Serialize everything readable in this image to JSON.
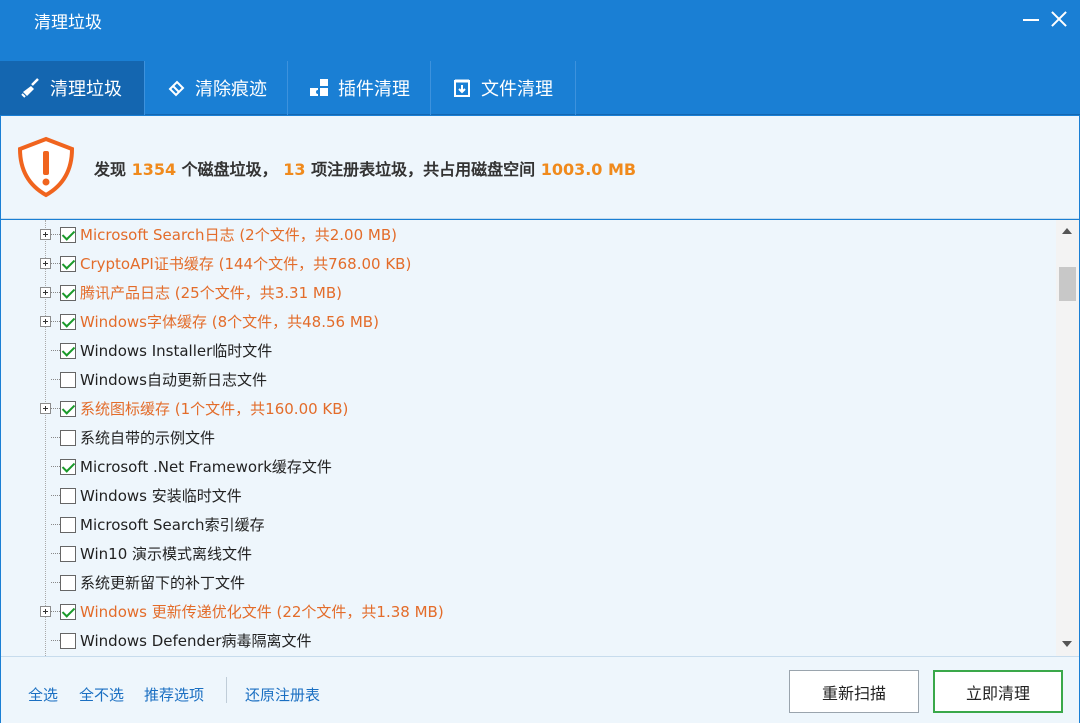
{
  "window": {
    "title": "清理垃圾"
  },
  "tabs": [
    {
      "label": "清理垃圾",
      "icon": "broom-icon",
      "active": true
    },
    {
      "label": "清除痕迹",
      "icon": "eraser-icon",
      "active": false
    },
    {
      "label": "插件清理",
      "icon": "puzzle-icon",
      "active": false
    },
    {
      "label": "文件清理",
      "icon": "file-clean-icon",
      "active": false
    }
  ],
  "summary": {
    "prefix": "发现 ",
    "disk_count": "1354",
    "mid1": " 个磁盘垃圾， ",
    "registry_count": "13",
    "mid2": " 项注册表垃圾，共占用磁盘空间 ",
    "total_size": "1003.0 MB",
    "warning_icon": "shield-warning-icon"
  },
  "items": [
    {
      "label": "Microsoft Search日志 (2个文件，共2.00 MB)",
      "checked": true,
      "expandable": true,
      "highlight": true
    },
    {
      "label": "CryptoAPI证书缓存 (144个文件，共768.00 KB)",
      "checked": true,
      "expandable": true,
      "highlight": true
    },
    {
      "label": "腾讯产品日志 (25个文件，共3.31 MB)",
      "checked": true,
      "expandable": true,
      "highlight": true
    },
    {
      "label": "Windows字体缓存 (8个文件，共48.56 MB)",
      "checked": true,
      "expandable": true,
      "highlight": true
    },
    {
      "label": "Windows Installer临时文件",
      "checked": true,
      "expandable": false,
      "highlight": false
    },
    {
      "label": "Windows自动更新日志文件",
      "checked": false,
      "expandable": false,
      "highlight": false
    },
    {
      "label": "系统图标缓存 (1个文件，共160.00 KB)",
      "checked": true,
      "expandable": true,
      "highlight": true
    },
    {
      "label": "系统自带的示例文件",
      "checked": false,
      "expandable": false,
      "highlight": false
    },
    {
      "label": "Microsoft .Net Framework缓存文件",
      "checked": true,
      "expandable": false,
      "highlight": false
    },
    {
      "label": "Windows 安装临时文件",
      "checked": false,
      "expandable": false,
      "highlight": false
    },
    {
      "label": "Microsoft Search索引缓存",
      "checked": false,
      "expandable": false,
      "highlight": false
    },
    {
      "label": "Win10 演示模式离线文件",
      "checked": false,
      "expandable": false,
      "highlight": false
    },
    {
      "label": "系统更新留下的补丁文件",
      "checked": false,
      "expandable": false,
      "highlight": false
    },
    {
      "label": "Windows 更新传递优化文件 (22个文件，共1.38 MB)",
      "checked": true,
      "expandable": true,
      "highlight": true
    },
    {
      "label": "Windows Defender病毒隔离文件",
      "checked": false,
      "expandable": false,
      "highlight": false
    }
  ],
  "footer": {
    "select_all": "全选",
    "select_none": "全不选",
    "recommended": "推荐选项",
    "restore_registry": "还原注册表",
    "rescan": "重新扫描",
    "clean_now": "立即清理"
  },
  "colors": {
    "accent": "#1a7fd4",
    "warning": "#f08a1c",
    "highlight_text": "#e36c2a",
    "check": "#1a9a2a"
  }
}
